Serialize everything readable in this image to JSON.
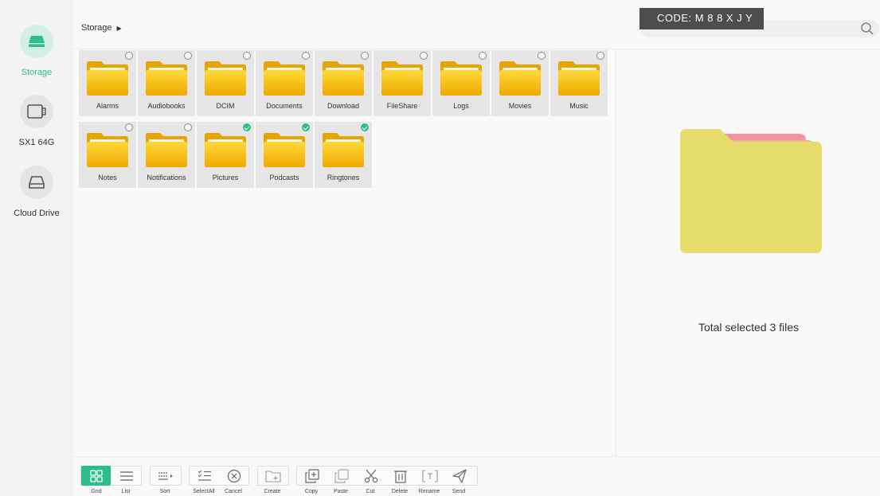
{
  "sidebar": {
    "items": [
      {
        "label": "Storage",
        "icon": "drive-icon",
        "active": true
      },
      {
        "label": "SX1 64G",
        "icon": "usb-icon",
        "active": false
      },
      {
        "label": "Cloud Drive",
        "icon": "cloud-drive-icon",
        "active": false
      }
    ]
  },
  "header": {
    "breadcrumb": "Storage",
    "search_placeholder": "Search",
    "code_badge": "CODE: M 8 8 X J Y"
  },
  "folders": [
    {
      "name": "Alarms",
      "selected": false
    },
    {
      "name": "Audiobooks",
      "selected": false
    },
    {
      "name": "DCIM",
      "selected": false
    },
    {
      "name": "Documents",
      "selected": false
    },
    {
      "name": "Download",
      "selected": false
    },
    {
      "name": "FileShare",
      "selected": false
    },
    {
      "name": "Logs",
      "selected": false
    },
    {
      "name": "Movies",
      "selected": false
    },
    {
      "name": "Music",
      "selected": false
    },
    {
      "name": "Notes",
      "selected": false
    },
    {
      "name": "Notifications",
      "selected": false
    },
    {
      "name": "Pictures",
      "selected": true
    },
    {
      "name": "Podcasts",
      "selected": true
    },
    {
      "name": "Ringtones",
      "selected": true
    }
  ],
  "preview": {
    "status_text": "Total selected 3 files"
  },
  "toolbar": {
    "grid": "Grid",
    "list": "List",
    "sort": "Sort",
    "select_all": "SelectAll",
    "cancel": "Cancel",
    "create": "Create",
    "copy": "Copy",
    "paste": "Paste",
    "cut": "Cut",
    "delete": "Delete",
    "rename": "Rename",
    "send": "Send"
  },
  "colors": {
    "accent": "#2bbd8b",
    "folder_yellow": "#f2c21b",
    "preview_folder": "#e6dc6c"
  }
}
